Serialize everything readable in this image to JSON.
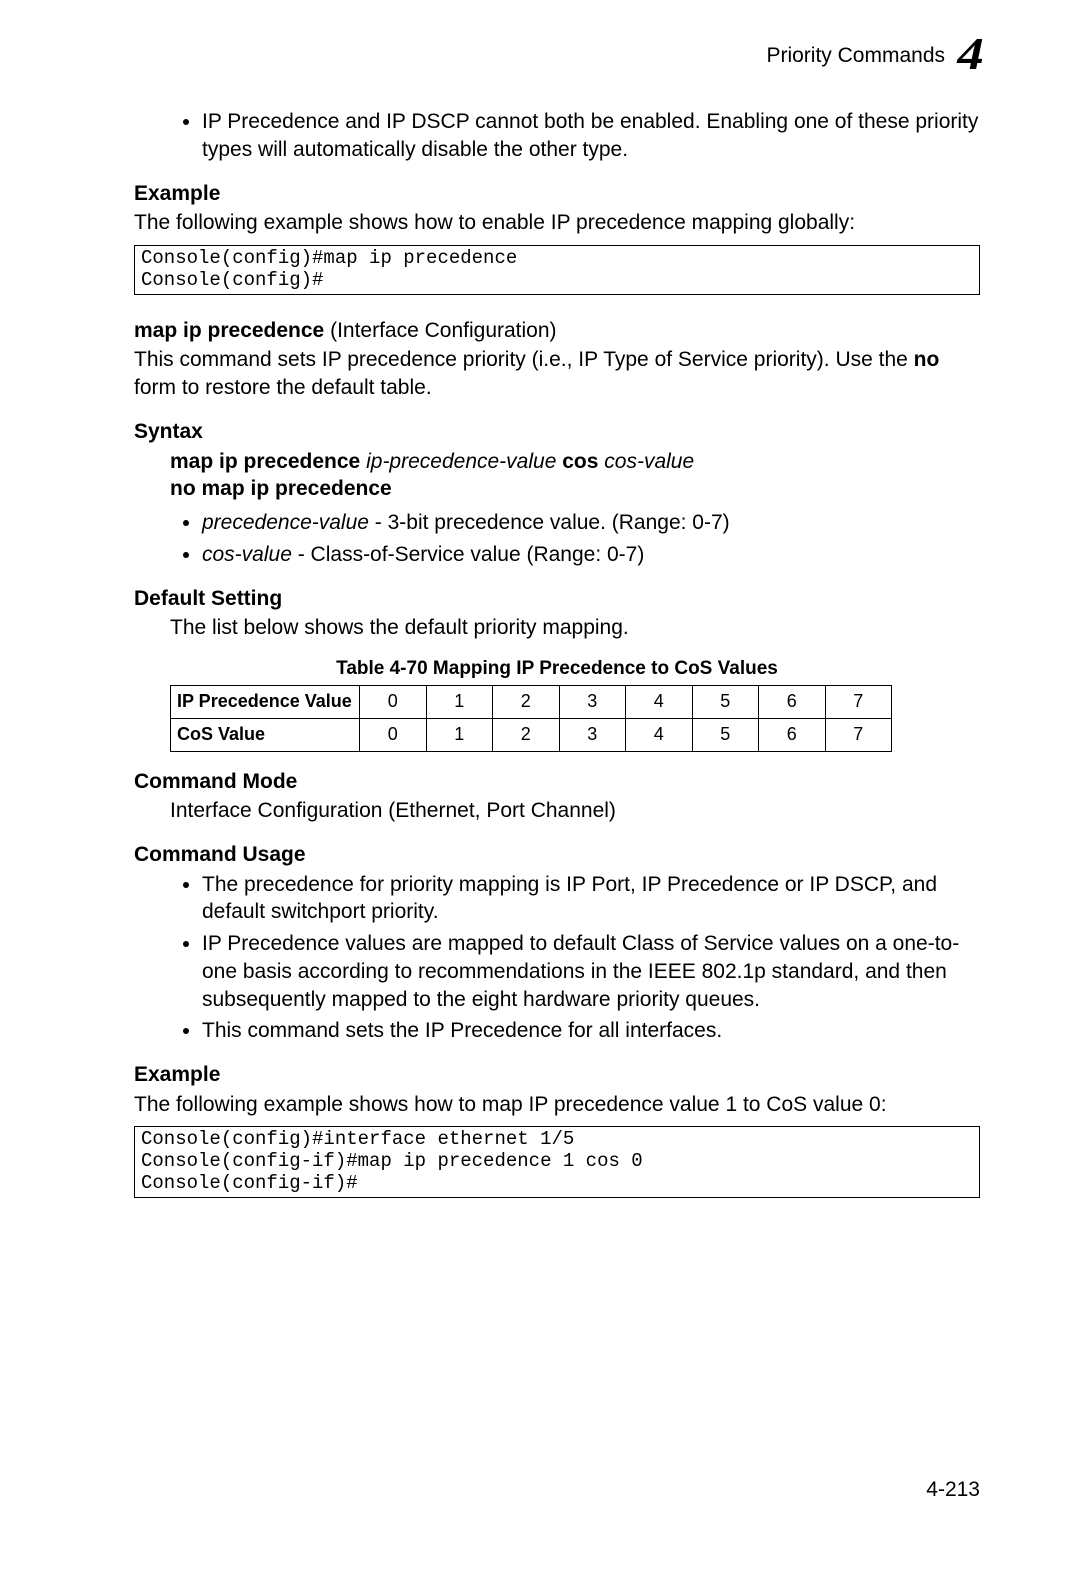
{
  "header": {
    "running_head": "Priority Commands",
    "chapter_number": "4"
  },
  "intro_bullet": "IP Precedence and IP DSCP cannot both be enabled. Enabling one of these priority types will automatically disable the other type.",
  "example1": {
    "heading": "Example",
    "intro": "The following example shows how to enable IP precedence mapping globally:",
    "code": "Console(config)#map ip precedence\nConsole(config)#"
  },
  "cmd2": {
    "title_bold": "map ip precedence",
    "title_rest": " (Interface Configuration)",
    "desc_pre": "This command sets IP precedence priority (i.e., IP Type of Service priority). Use the ",
    "desc_no": "no",
    "desc_post": " form to restore the default table."
  },
  "syntax": {
    "heading": "Syntax",
    "line1_a": "map ip precedence",
    "line1_b": "ip-precedence-value",
    "line1_c": "cos",
    "line1_d": "cos-value",
    "line2": "no map ip precedence",
    "param1_i": "precedence-value",
    "param1_t": " - 3-bit precedence value. (Range: 0-7)",
    "param2_i": "cos-value",
    "param2_t": " - Class-of-Service value (Range: 0-7)"
  },
  "default_setting": {
    "heading": "Default Setting",
    "text": "The list below shows the default priority mapping."
  },
  "table": {
    "caption": "Table 4-70   Mapping IP Precedence to CoS Values",
    "row1_label": "IP Precedence Value",
    "row2_label": "CoS Value",
    "cells": [
      "0",
      "1",
      "2",
      "3",
      "4",
      "5",
      "6",
      "7"
    ]
  },
  "command_mode": {
    "heading": "Command Mode",
    "text": "Interface Configuration (Ethernet, Port Channel)"
  },
  "command_usage": {
    "heading": "Command Usage",
    "b1": "The precedence for priority mapping is IP Port, IP Precedence or IP DSCP, and default switchport priority.",
    "b2": "IP Precedence values are mapped to default Class of Service values on a one-to-one basis according to recommendations in the IEEE 802.1p standard, and then subsequently mapped to the eight hardware priority queues.",
    "b3": "This command sets the IP Precedence for all interfaces."
  },
  "example2": {
    "heading": "Example",
    "intro": "The following example shows how to map IP precedence value 1 to CoS value 0:",
    "code": "Console(config)#interface ethernet 1/5\nConsole(config-if)#map ip precedence 1 cos 0\nConsole(config-if)#"
  },
  "page_number": "4-213"
}
